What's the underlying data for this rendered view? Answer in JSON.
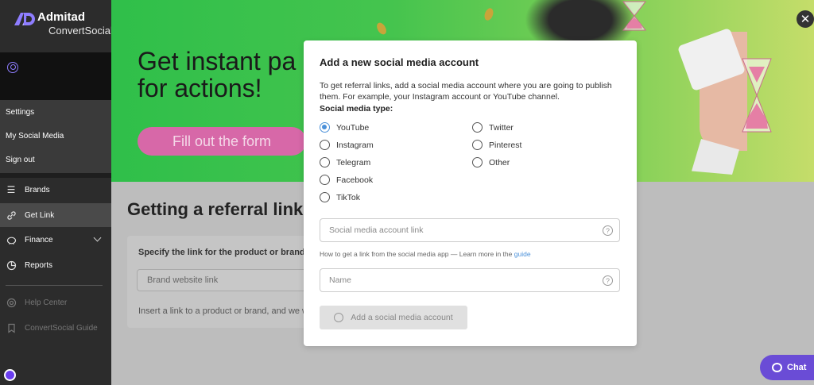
{
  "brand": {
    "name": "Admitad",
    "product": "ConvertSocial"
  },
  "account_menu": [
    "Settings",
    "My Social Media",
    "Sign out"
  ],
  "nav": [
    {
      "label": "Brands",
      "icon": "layers-icon"
    },
    {
      "label": "Get Link",
      "icon": "link-icon",
      "active": true
    },
    {
      "label": "Finance",
      "icon": "piggy-bank-icon"
    },
    {
      "label": "Reports",
      "icon": "pie-chart-icon"
    }
  ],
  "nav_secondary": [
    {
      "label": "Help Center",
      "icon": "help-icon"
    },
    {
      "label": "ConvertSocial Guide",
      "icon": "bookmark-icon"
    }
  ],
  "banner": {
    "title": "Get instant pa\nfor actions!",
    "button": "Fill out the form"
  },
  "main": {
    "title": "Getting a referral link",
    "card_label": "Specify the link for the product or brand",
    "input_placeholder": "Brand website link",
    "hint": "Insert a link to a product or brand, and we will"
  },
  "modal": {
    "title": "Add a new social media account",
    "description": "To get referral links, add a social media account where you are going to publish them. For example, your Instagram account or YouTube channel.",
    "type_label": "Social media type:",
    "options_left": [
      "YouTube",
      "Instagram",
      "Telegram",
      "Facebook",
      "TikTok"
    ],
    "options_right": [
      "Twitter",
      "Pinterest",
      "Other"
    ],
    "selected": "YouTube",
    "link_placeholder": "Social media account link",
    "link_hint": "How to get a link from the social media app — Learn more in the",
    "link_hint_link": "guide",
    "name_placeholder": "Name",
    "help_glyph": "?",
    "submit": "Add a social media account"
  },
  "chat": {
    "label": "Chat"
  },
  "close_glyph": "✕",
  "colors": {
    "accent": "#4a90d9",
    "chat": "#6a4cd6",
    "banner_green": "#45c44e",
    "button_pink": "#d768a8"
  }
}
